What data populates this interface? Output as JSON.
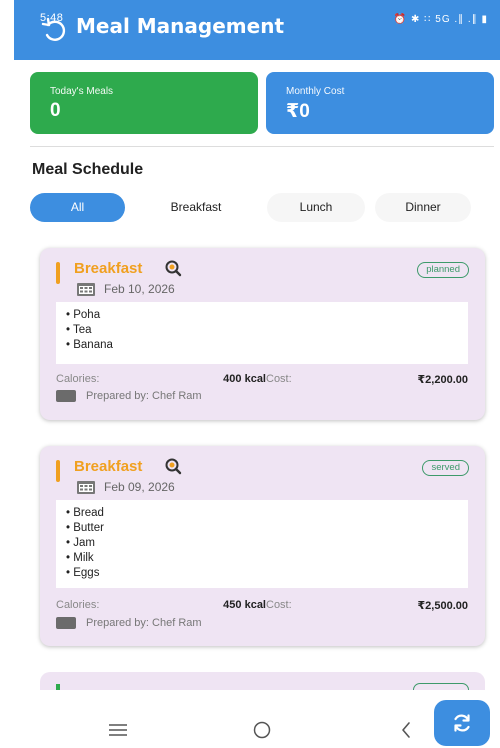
{
  "status_bar": {
    "time": "5:48",
    "icons_text": "⏰ ✱ ∷ 5G .∥ .∥ ▮"
  },
  "appbar": {
    "title": "Meal Management"
  },
  "stats": {
    "today": {
      "label": "Today's Meals",
      "value": "0"
    },
    "monthly": {
      "label": "Monthly Cost",
      "value": "₹0"
    }
  },
  "section": {
    "title": "Meal Schedule"
  },
  "filters": [
    {
      "label": "All",
      "active": true
    },
    {
      "label": "Breakfast",
      "active": false
    },
    {
      "label": "Lunch",
      "active": false
    },
    {
      "label": "Dinner",
      "active": false
    }
  ],
  "meals": [
    {
      "type": "Breakfast",
      "date": "Feb 10, 2026",
      "status": "planned",
      "items": [
        "Poha",
        "Tea",
        "Banana"
      ],
      "calories_label": "Calories:",
      "calories": "400 kcal",
      "cost_label": "Cost:",
      "cost": "₹2,200.00",
      "prepared_by": "Prepared by: Chef Ram"
    },
    {
      "type": "Breakfast",
      "date": "Feb 09, 2026",
      "status": "served",
      "items": [
        "Bread",
        "Butter",
        "Jam",
        "Milk",
        "Eggs"
      ],
      "calories_label": "Calories:",
      "calories": "450 kcal",
      "cost_label": "Cost:",
      "cost": "₹2,500.00",
      "prepared_by": "Prepared by: Chef Ram"
    }
  ],
  "colors": {
    "primary": "#3d8ee0",
    "green": "#2eaa4d",
    "card_bg": "#efe4f3",
    "accent_orange": "#f0a020",
    "badge_green": "#3d9a6a"
  },
  "icons": {
    "back": "refresh-back-icon",
    "meal": "search-icon",
    "calendar": "calendar-icon",
    "chef": "chef-icon",
    "fab": "refresh-icon",
    "nav_menu": "menu-icon",
    "nav_home": "home-circle-icon",
    "nav_back": "back-chevron-icon"
  }
}
